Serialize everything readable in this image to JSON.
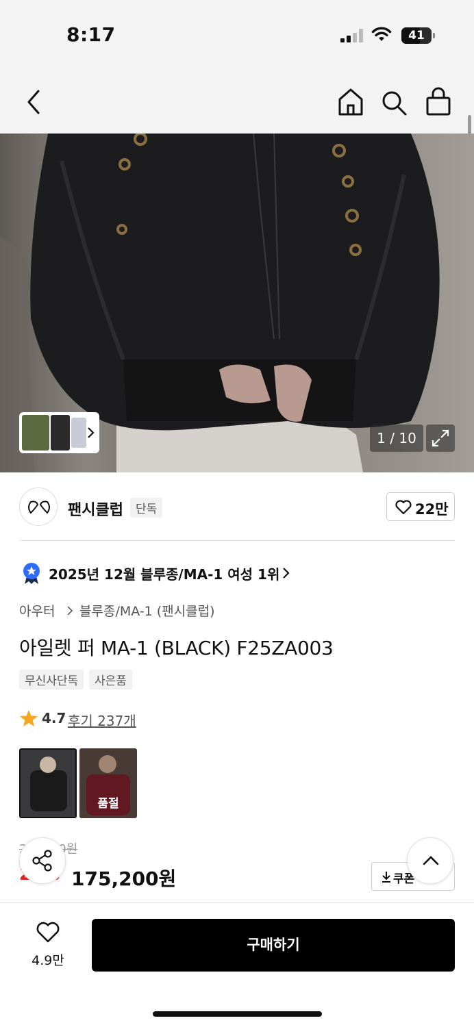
{
  "status_bar": {
    "time": "8:17",
    "battery": "41"
  },
  "nav": {
    "back_icon": "chevron-left-icon",
    "icons": [
      "home-icon",
      "search-icon",
      "shopping-bag-icon"
    ]
  },
  "gallery": {
    "counter": "1 / 10"
  },
  "brand": {
    "name": "팬시클럽",
    "badge": "단독",
    "likes": "22만"
  },
  "ranking": {
    "text": "2025년 12월 블루종/MA-1 여성 1위"
  },
  "breadcrumb": {
    "level1": "아우터",
    "level2": "블루종/MA-1 (팬시클럽)"
  },
  "product": {
    "title": "아일렛 퍼 MA-1 (BLACK) F25ZA003",
    "tags": [
      "무신사단독",
      "사은품"
    ],
    "rating": "4.7",
    "reviews": "후기 237개",
    "options": [
      {
        "color": "black",
        "selected": true
      },
      {
        "color": "burgundy",
        "label": "품절"
      }
    ],
    "original_price": "2??,?00원",
    "discount": "2?%",
    "price": "175,200원",
    "coupon": "쿠폰"
  },
  "bottom_bar": {
    "wish_count": "4.9만",
    "buy_label": "구매하기"
  },
  "colors": {
    "accent": "#000000",
    "discount": "#e0271f",
    "rank_badge": "#2f6bff",
    "star": "#f5a623"
  }
}
